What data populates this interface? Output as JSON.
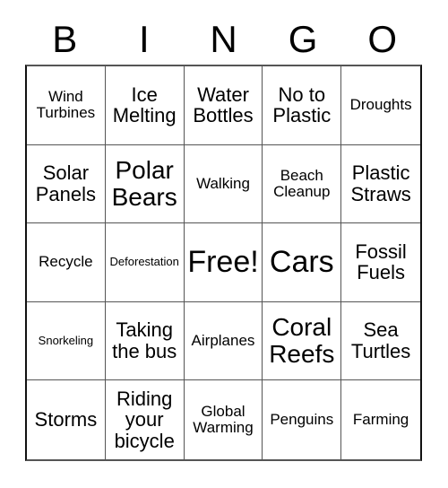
{
  "card": {
    "title_letters": [
      "B",
      "I",
      "N",
      "G",
      "O"
    ],
    "columns": 5,
    "rows": 5,
    "free_space_label": "Free!",
    "theme_color": "#000000",
    "grid_line_color": "#555555",
    "grid_border_color": "#111111",
    "background_color": "#ffffff"
  },
  "cells": [
    {
      "line1": "Wind",
      "line2": "Turbines",
      "text": "Wind\nTurbines",
      "size": "sm"
    },
    {
      "line1": "Ice",
      "line2": "Melting",
      "text": "Ice\nMelting",
      "size": "md"
    },
    {
      "line1": "Water",
      "line2": "Bottles",
      "text": "Water\nBottles",
      "size": "md"
    },
    {
      "line1": "No to",
      "line2": "Plastic",
      "text": "No to\nPlastic",
      "size": "md"
    },
    {
      "line1": "Droughts",
      "line2": "",
      "text": "Droughts",
      "size": "sm"
    },
    {
      "line1": "Solar",
      "line2": "Panels",
      "text": "Solar\nPanels",
      "size": "md"
    },
    {
      "line1": "Polar",
      "line2": "Bears",
      "text": "Polar\nBears",
      "size": "lg"
    },
    {
      "line1": "Walking",
      "line2": "",
      "text": "Walking",
      "size": "sm"
    },
    {
      "line1": "Beach",
      "line2": "Cleanup",
      "text": "Beach\nCleanup",
      "size": "sm"
    },
    {
      "line1": "Plastic",
      "line2": "Straws",
      "text": "Plastic\nStraws",
      "size": "md"
    },
    {
      "line1": "Recycle",
      "line2": "",
      "text": "Recycle",
      "size": "sm"
    },
    {
      "line1": "Deforestation",
      "line2": "",
      "text": "Deforestation",
      "size": "xs"
    },
    {
      "line1": "Free!",
      "line2": "",
      "text": "Free!",
      "size": "xl"
    },
    {
      "line1": "Cars",
      "line2": "",
      "text": "Cars",
      "size": "xl"
    },
    {
      "line1": "Fossil",
      "line2": "Fuels",
      "text": "Fossil\nFuels",
      "size": "md"
    },
    {
      "line1": "Snorkeling",
      "line2": "",
      "text": "Snorkeling",
      "size": "xs"
    },
    {
      "line1": "Taking",
      "line2": "the bus",
      "text": "Taking\nthe bus",
      "size": "md"
    },
    {
      "line1": "Airplanes",
      "line2": "",
      "text": "Airplanes",
      "size": "sm"
    },
    {
      "line1": "Coral",
      "line2": "Reefs",
      "text": "Coral\nReefs",
      "size": "lg"
    },
    {
      "line1": "Sea",
      "line2": "Turtles",
      "text": "Sea\nTurtles",
      "size": "md"
    },
    {
      "line1": "Storms",
      "line2": "",
      "text": "Storms",
      "size": "md"
    },
    {
      "line1": "Riding",
      "line2": "your bicycle",
      "text": "Riding\nyour\nbicycle",
      "size": "md"
    },
    {
      "line1": "Global",
      "line2": "Warming",
      "text": "Global\nWarming",
      "size": "sm"
    },
    {
      "line1": "Penguins",
      "line2": "",
      "text": "Penguins",
      "size": "sm"
    },
    {
      "line1": "Farming",
      "line2": "",
      "text": "Farming",
      "size": "sm"
    }
  ]
}
